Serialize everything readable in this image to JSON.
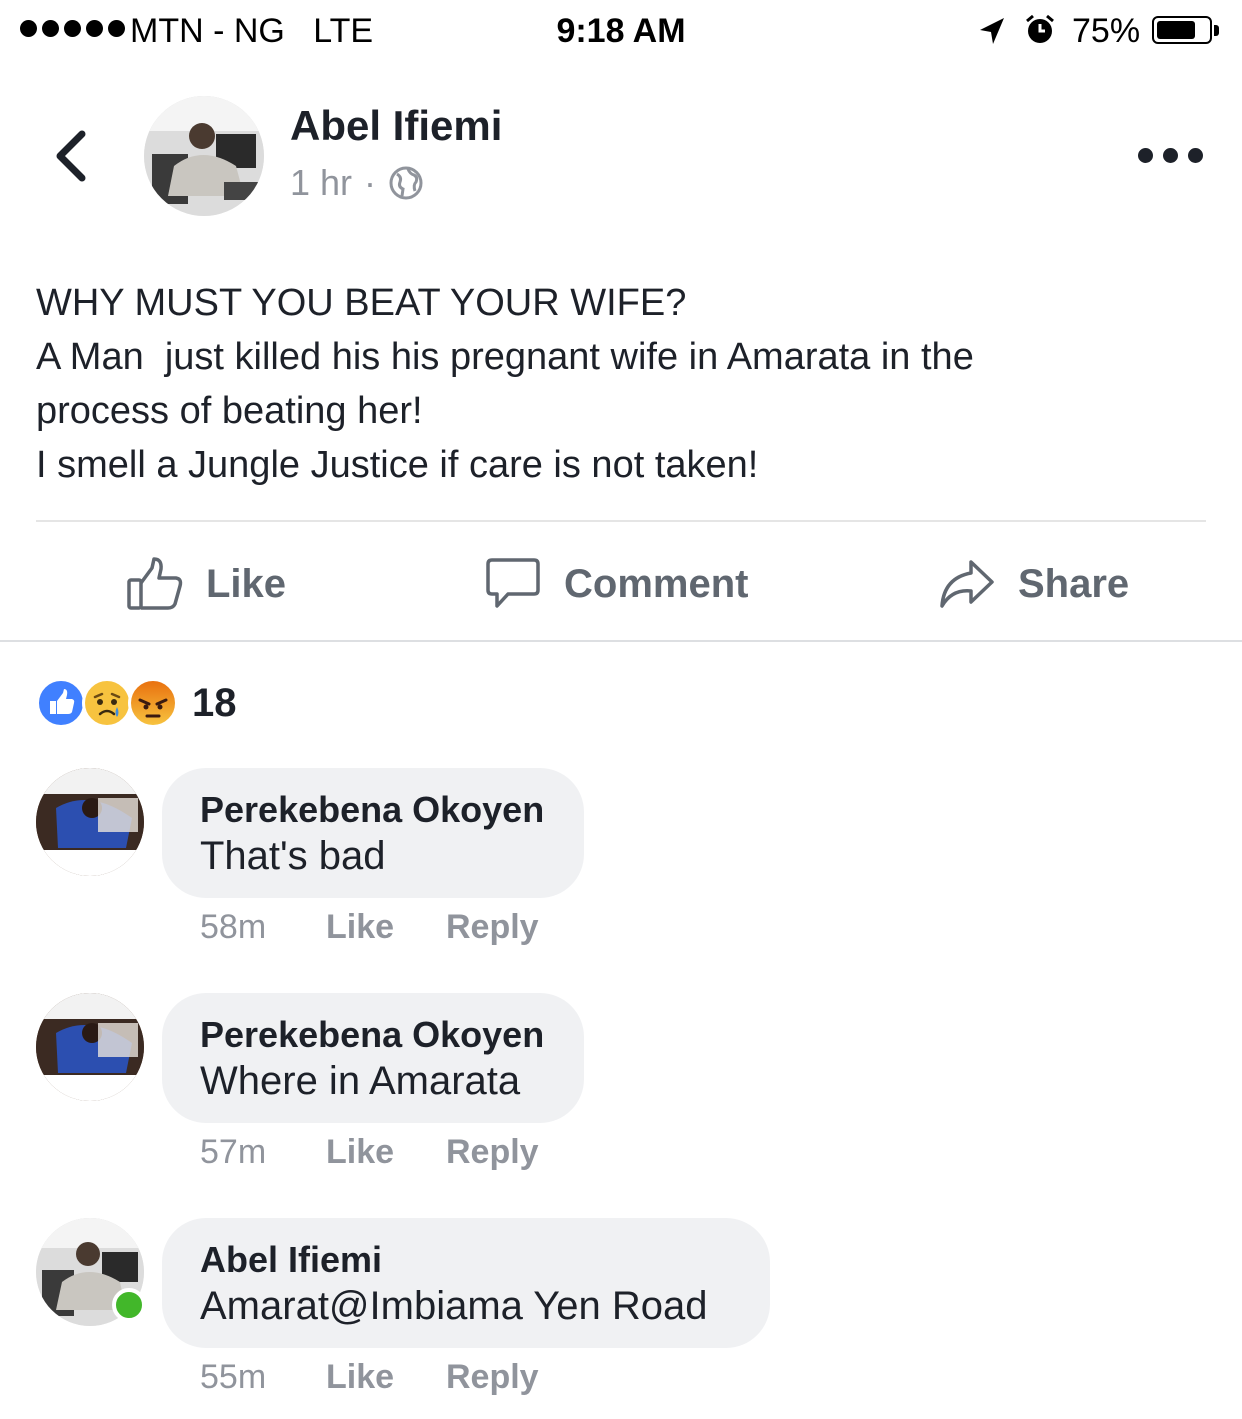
{
  "status_bar": {
    "carrier": "MTN - NG",
    "network": "LTE",
    "time": "9:18 AM",
    "battery": "75%",
    "battery_level": 0.75,
    "signal_bars": 5
  },
  "post": {
    "author": "Abel Ifiemi",
    "time": "1 hr",
    "separator": "·",
    "privacy_icon": "globe-icon",
    "lines": [
      "WHY MUST YOU BEAT YOUR WIFE?",
      "A Man  just killed his his pregnant wife in Amarata in the",
      "process of beating her!",
      "I smell a Jungle Justice if care is not taken!"
    ]
  },
  "actions": {
    "like": "Like",
    "comment": "Comment",
    "share": "Share"
  },
  "reactions": {
    "count": "18",
    "types": [
      "like",
      "sad",
      "angry"
    ],
    "colors": {
      "like": "#4080ff",
      "sad": "#f7c33f",
      "angry": "#e9710f"
    }
  },
  "comments": [
    {
      "author": "Perekebena Okoyen",
      "text": "That's bad",
      "time": "58m",
      "like": "Like",
      "reply": "Reply"
    },
    {
      "author": "Perekebena Okoyen",
      "text": "Where in Amarata",
      "time": "57m",
      "like": "Like",
      "reply": "Reply"
    },
    {
      "author": "Abel Ifiemi",
      "text": "Amarat@Imbiama Yen Road",
      "time": "55m",
      "like": "Like",
      "reply": "Reply",
      "online": true
    }
  ]
}
